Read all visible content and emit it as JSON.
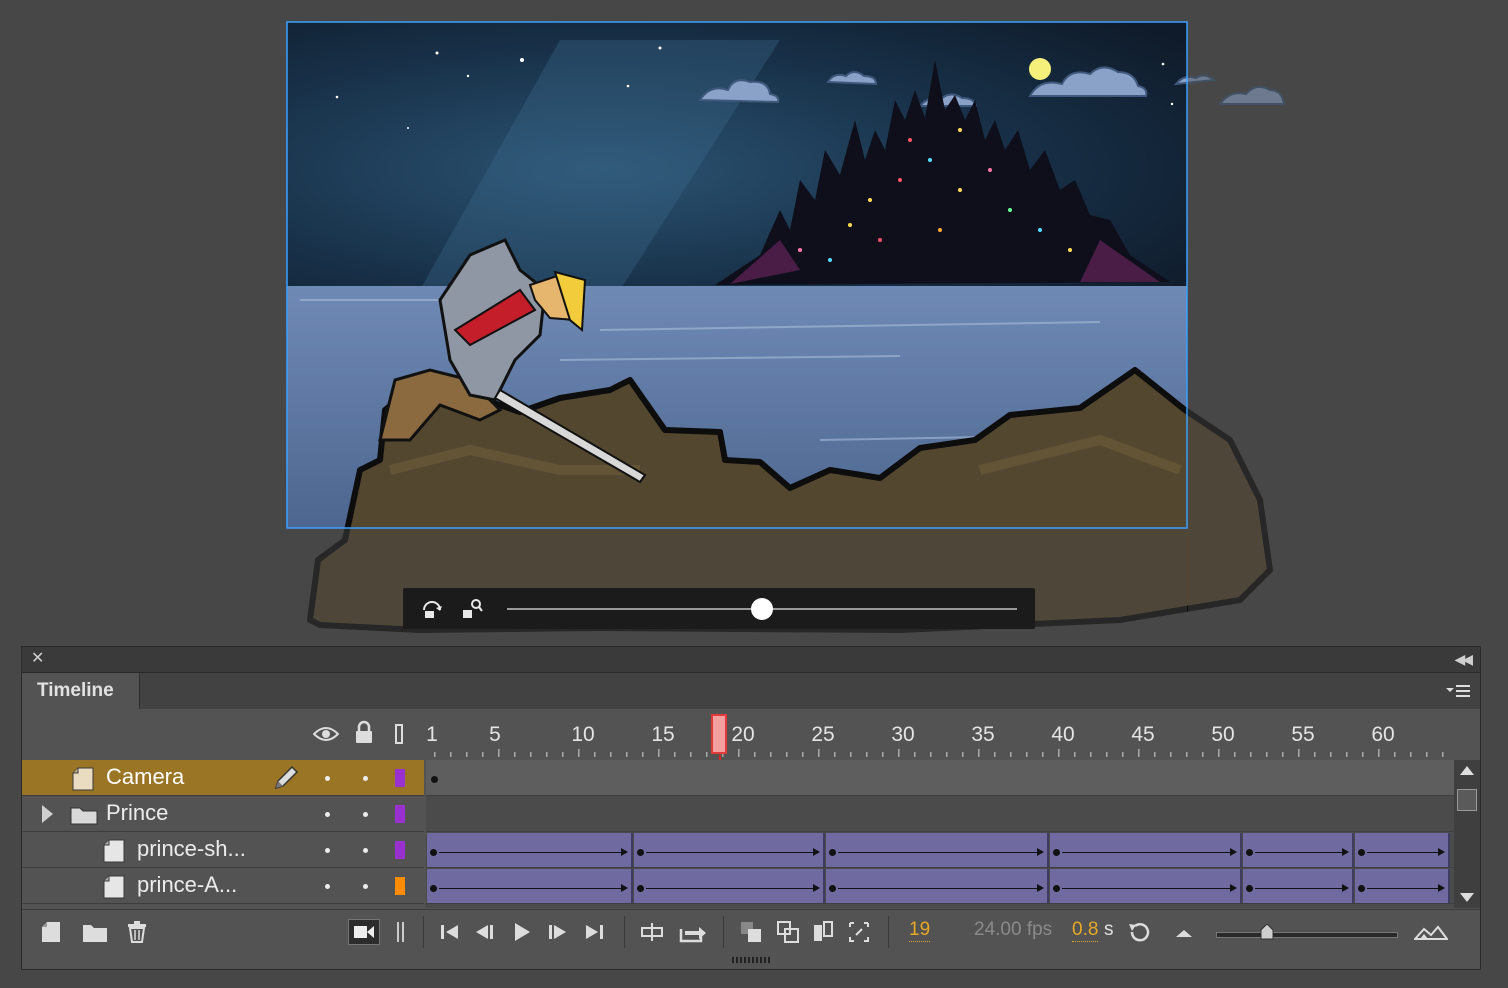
{
  "panel": {
    "tab_title": "Timeline"
  },
  "ruler": {
    "labels": [
      "1",
      "5",
      "10",
      "15",
      "20",
      "25",
      "30",
      "35",
      "40",
      "45",
      "50",
      "55",
      "60"
    ]
  },
  "layers": [
    {
      "name": "Camera",
      "type": "camera",
      "selected": true,
      "color": "#9b30d0"
    },
    {
      "name": "Prince",
      "type": "folder",
      "selected": false,
      "color": "#9b30d0"
    },
    {
      "name": "prince-sh...",
      "type": "layer",
      "selected": false,
      "color": "#9b30d0"
    },
    {
      "name": "prince-A...",
      "type": "layer",
      "selected": false,
      "color": "#ff8c00"
    }
  ],
  "status": {
    "current_frame": "19",
    "fps": "24.00 fps",
    "seconds": "0.8",
    "seconds_unit": "s"
  },
  "playhead_frame": 19,
  "colors": {
    "accent_orange": "#e8a824",
    "selection": "#9a7526",
    "tween": "#6f6aa0",
    "playhead": "#d22222"
  },
  "icons": [
    "close-icon",
    "collapse-icon",
    "panel-menu-icon",
    "eye-icon",
    "lock-icon",
    "outline-icon",
    "pencil-icon",
    "new-layer-icon",
    "new-folder-icon",
    "delete-icon",
    "camera-toggle-icon",
    "first-frame-icon",
    "prev-frame-icon",
    "play-icon",
    "next-frame-icon",
    "last-frame-icon",
    "center-frame-icon",
    "loop-icon",
    "onion-skin-icon",
    "onion-outline-icon",
    "edit-multiple-icon",
    "modify-markers-icon",
    "rotate-icon",
    "zoom-out-icon",
    "zoom-in-icon",
    "camera-rotate-icon",
    "camera-zoom-icon"
  ]
}
